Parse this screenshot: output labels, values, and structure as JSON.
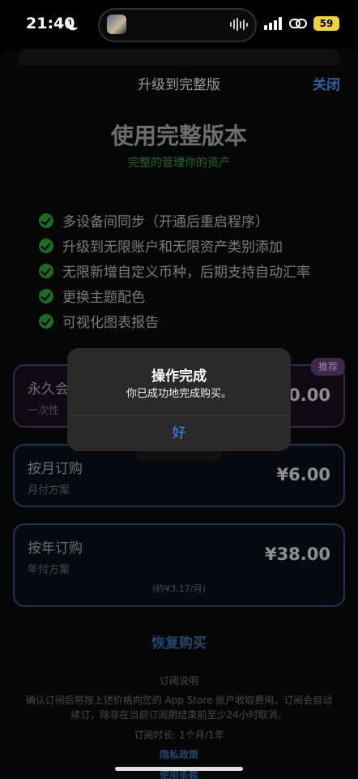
{
  "status_bar": {
    "time": "21:40",
    "battery": "59",
    "icons": [
      "moon-icon",
      "album-thumbnail",
      "waveform-icon",
      "signal-icon",
      "link-icon",
      "battery-icon"
    ]
  },
  "nav": {
    "title": "升级到完整版",
    "close_label": "关闭"
  },
  "hero": {
    "title": "使用完整版本",
    "subtitle": "完整的管理你的资产"
  },
  "features": [
    {
      "text": "多设备间同步（开通后重启程序）"
    },
    {
      "text": "升级到无限账户和无限资产类别添加"
    },
    {
      "text": "无限新增自定义币种，后期支持自动汇率"
    },
    {
      "text": "更换主题配色"
    },
    {
      "text": "可视化图表报告"
    }
  ],
  "plans": {
    "lifetime": {
      "name": "永久会",
      "desc": "一次性",
      "price": "0.00",
      "badge": "推荐"
    },
    "monthly": {
      "name": "按月订购",
      "desc": "月付方案",
      "price": "¥6.00"
    },
    "yearly": {
      "name": "按年订购",
      "desc": "年付方案",
      "price": "¥38.00",
      "note": "(约¥3.17/月)"
    }
  },
  "footer": {
    "restore_label": "恢复购买",
    "subscription_heading": "订阅说明",
    "subscription_body": "确认订阅后将按上述价格向您的 App Store 账户收取费用。订阅会自动续订，除非在当前订阅期结束前至少24小时取消。",
    "subscription_duration": "订阅时长: 1个月/1年",
    "privacy_label": "隐私政策",
    "terms_label": "使用条款"
  },
  "alert": {
    "title": "操作完成",
    "message": "你已成功地完成购买。",
    "ok_label": "好"
  },
  "colors": {
    "accent_blue": "#3b8cf6",
    "check_green": "#1c6b25",
    "recommend_purple": "#40284b",
    "battery_yellow": "#f2d23c"
  }
}
